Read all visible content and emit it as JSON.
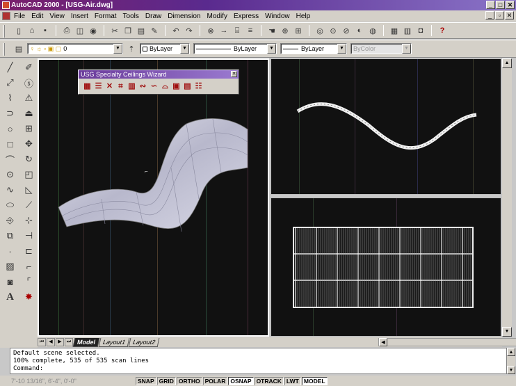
{
  "window": {
    "title": "AutoCAD 2000 - [USG-Air.dwg]",
    "min": "_",
    "max": "□",
    "close": "✕"
  },
  "menu": [
    "File",
    "Edit",
    "View",
    "Insert",
    "Format",
    "Tools",
    "Draw",
    "Dimension",
    "Modify",
    "Express",
    "Window",
    "Help"
  ],
  "layers": {
    "current_layer": "0",
    "color": "ByLayer",
    "linetype": "ByLayer",
    "lineweight": "ByLayer",
    "plotstyle": "ByColor"
  },
  "wizard": {
    "title": "USG Specialty Ceilings Wizard",
    "close": "✕"
  },
  "tabs": [
    "Model",
    "Layout1",
    "Layout2"
  ],
  "command_lines": [
    "Default scene selected.",
    "100% complete, 535 of 535 scan lines",
    "Command:"
  ],
  "status": {
    "coords": "7'-10 13/16\",  6'-4\",  0'-0\"",
    "buttons": [
      "SNAP",
      "GRID",
      "ORTHO",
      "POLAR",
      "OSNAP",
      "OTRACK",
      "LWT",
      "MODEL"
    ],
    "active": [
      "OSNAP",
      "MODEL"
    ]
  },
  "colors": {
    "titlebar_start": "#7a1f6b",
    "titlebar_end": "#8a74c8",
    "viewport_bg": "#111111",
    "surface": "#c8c8d8"
  }
}
